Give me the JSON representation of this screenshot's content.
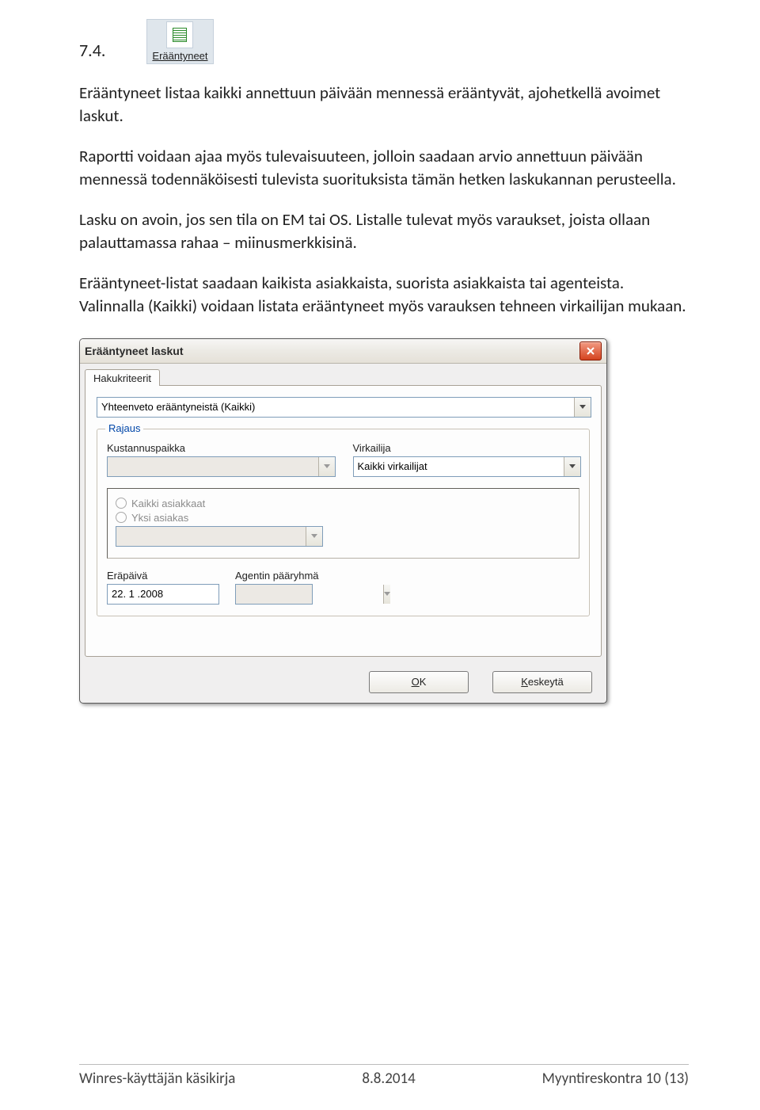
{
  "section": {
    "number": "7.4."
  },
  "toolbar_btn": {
    "label": "Erääntyneet"
  },
  "paras": {
    "p1": "Erääntyneet listaa kaikki annettuun päivään mennessä erääntyvät, ajohetkellä avoimet laskut.",
    "p2": "Raportti voidaan ajaa myös tulevaisuuteen, jolloin saadaan arvio annettuun päivään mennessä todennäköisesti tulevista suorituksista tämän hetken laskukannan perusteella.",
    "p3": "Lasku on avoin, jos sen tila on EM tai OS. Listalle tulevat myös varaukset, joista ollaan palauttamassa rahaa – miinusmerkkisinä.",
    "p4": "Erääntyneet-listat saadaan kaikista asiakkaista, suorista asiakkaista tai agenteista. Valinnalla (Kaikki) voidaan listata erääntyneet myös varauksen tehneen virkailijan mukaan."
  },
  "dialog": {
    "title": "Erääntyneet laskut",
    "tab": "Hakukriteerit",
    "summary_value": "Yhteenveto erääntyneistä (Kaikki)",
    "fieldset_legend": "Rajaus",
    "kustannuspaikka_label": "Kustannuspaikka",
    "virkailija_label": "Virkailija",
    "virkailija_value": "Kaikki virkailijat",
    "radio1": "Kaikki asiakkaat",
    "radio2": "Yksi asiakas",
    "erapaiva_label": "Eräpäivä",
    "erapaiva_value": "22. 1 .2008",
    "agent_label": "Agentin pääryhmä",
    "ok_u": "O",
    "ok_rest": "K",
    "cancel_u": "K",
    "cancel_rest": "eskeytä"
  },
  "footer": {
    "left": "Winres-käyttäjän käsikirja",
    "center": "8.8.2014",
    "right": "Myyntireskontra 10 (13)"
  }
}
